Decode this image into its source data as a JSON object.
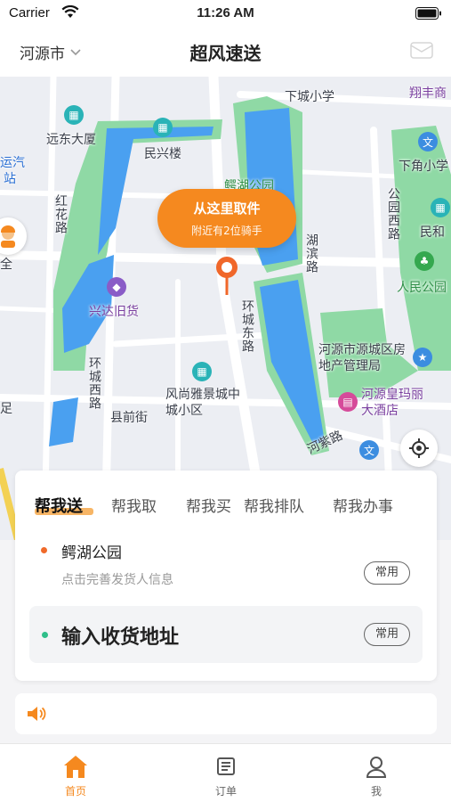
{
  "status_bar": {
    "carrier": "Carrier",
    "time": "11:26 AM"
  },
  "nav": {
    "city": "河源市",
    "title": "超风速送"
  },
  "map": {
    "labels": {
      "xiacheng_school": "下城小学",
      "xiangfeng": "翔丰商",
      "yuandong": "远东大厦",
      "minxing": "民兴楼",
      "yunqi": "运汽",
      "zhan": "站",
      "xiajiao": "下角小学",
      "ehu_park": "鳄湖公园",
      "honghua_road": "红花路",
      "hubin_road": "湖滨路",
      "gongyuan_west": "公园西路",
      "minhe": "民和",
      "renmin_park": "人民公园",
      "xingda": "兴达旧货",
      "huancheng_east": "环城东路",
      "yuancheng_estate": "河源市源城区房地产管理局",
      "huancheng_west": "环城西路",
      "xianqian_street": "县前街",
      "fengshang": "风尚雅景城中城小区",
      "heyuan_hotel": "河源皇玛丽大酒店",
      "hezi_road": "河紫路",
      "zu": "足",
      "quan": "全"
    }
  },
  "pickup": {
    "main": "从这里取件",
    "sub": "附近有2位骑手"
  },
  "service_tabs": [
    "帮我送",
    "帮我取",
    "帮我买",
    "帮我排队",
    "帮我办事"
  ],
  "sender": {
    "name": "鳄湖公园",
    "hint": "点击完善发货人信息",
    "frequent": "常用"
  },
  "receiver": {
    "placeholder": "输入收货地址",
    "frequent": "常用"
  },
  "tab_bar": {
    "home": "首页",
    "orders": "订单",
    "me": "我"
  },
  "colors": {
    "accent": "#f5891f",
    "water": "#4aa0f0",
    "park": "#7ed39a"
  }
}
